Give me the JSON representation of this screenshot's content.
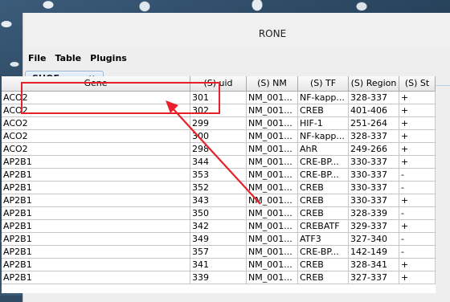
{
  "window": {
    "title": "RONE"
  },
  "menu": {
    "items": [
      "File",
      "Table",
      "Plugins"
    ]
  },
  "tab": {
    "label": "SHOE.csv",
    "close_glyph": "×"
  },
  "table": {
    "columns": [
      "Gene",
      "(S) uid",
      "(S) NM",
      "(S) TF",
      "(S) Region",
      "(S) St"
    ],
    "rows": [
      [
        "ACO2",
        "301",
        "NM_001...",
        "NF-kapp...",
        "328-337",
        "+"
      ],
      [
        "ACO2",
        "302",
        "NM_001...",
        "CREB",
        "401-406",
        "+"
      ],
      [
        "ACO2",
        "299",
        "NM_001...",
        "HIF-1",
        "251-264",
        "+"
      ],
      [
        "ACO2",
        "300",
        "NM_001...",
        "NF-kapp...",
        "328-337",
        "+"
      ],
      [
        "ACO2",
        "298",
        "NM_001...",
        "AhR",
        "249-266",
        "+"
      ],
      [
        "AP2B1",
        "344",
        "NM_001...",
        "CRE-BP...",
        "330-337",
        "+"
      ],
      [
        "AP2B1",
        "353",
        "NM_001...",
        "CRE-BP...",
        "330-337",
        "-"
      ],
      [
        "AP2B1",
        "352",
        "NM_001...",
        "CREB",
        "330-337",
        "-"
      ],
      [
        "AP2B1",
        "343",
        "NM_001...",
        "CREB",
        "330-337",
        "+"
      ],
      [
        "AP2B1",
        "350",
        "NM_001...",
        "CREB",
        "328-339",
        "-"
      ],
      [
        "AP2B1",
        "342",
        "NM_001...",
        "CREBATF",
        "329-337",
        "+"
      ],
      [
        "AP2B1",
        "349",
        "NM_001...",
        "ATF3",
        "327-340",
        "-"
      ],
      [
        "AP2B1",
        "357",
        "NM_001...",
        "CRE-BP...",
        "142-149",
        "-"
      ],
      [
        "AP2B1",
        "341",
        "NM_001...",
        "CREB",
        "328-341",
        "+"
      ],
      [
        "AP2B1",
        "339",
        "NM_001...",
        "CREB",
        "327-337",
        "+"
      ]
    ]
  },
  "annotation": {
    "color": "#e8202a"
  }
}
